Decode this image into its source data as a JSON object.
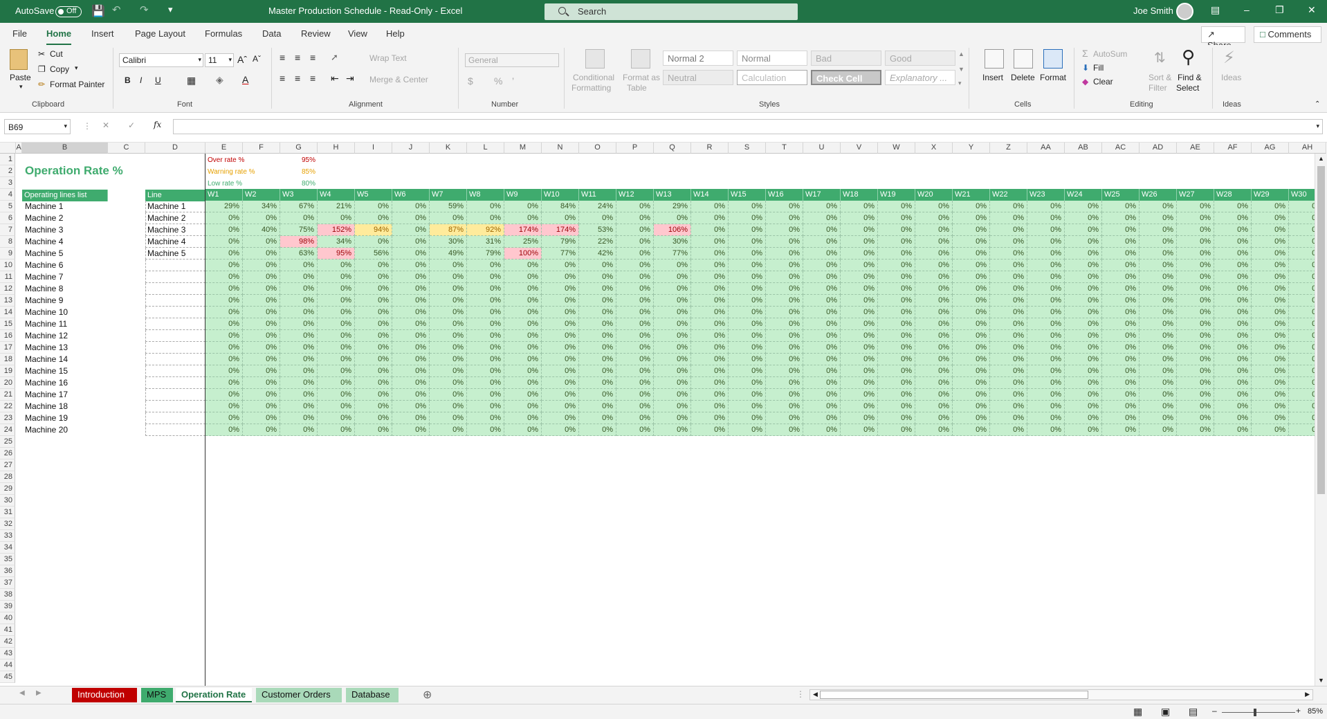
{
  "window": {
    "autosave": "AutoSave",
    "autosave_state": "Off",
    "title": "Master Production Schedule  -  Read-Only  -  Excel",
    "search": "Search",
    "user": "Joe Smith"
  },
  "menu": [
    "File",
    "Home",
    "Insert",
    "Page Layout",
    "Formulas",
    "Data",
    "Review",
    "View",
    "Help"
  ],
  "share": "Share",
  "comments": "Comments",
  "ribbon": {
    "clipboard": {
      "paste": "Paste",
      "cut": "Cut",
      "copy": "Copy",
      "format_painter": "Format Painter",
      "label": "Clipboard"
    },
    "font": {
      "name": "Calibri",
      "size": "11",
      "label": "Font"
    },
    "alignment": {
      "wrap": "Wrap Text",
      "merge": "Merge & Center",
      "label": "Alignment"
    },
    "number": {
      "format": "General",
      "label": "Number"
    },
    "styles": {
      "cond1": "Conditional",
      "cond2": "Formatting",
      "fmt1": "Format as",
      "fmt2": "Table",
      "normal2": "Normal 2",
      "normal": "Normal",
      "bad": "Bad",
      "good": "Good",
      "neutral": "Neutral",
      "calculation": "Calculation",
      "check": "Check Cell",
      "explanatory": "Explanatory ...",
      "label": "Styles"
    },
    "cells": {
      "insert": "Insert",
      "delete": "Delete",
      "format": "Format",
      "label": "Cells"
    },
    "editing": {
      "autosum": "AutoSum",
      "fill": "Fill",
      "clear": "Clear",
      "sort1": "Sort &",
      "sort2": "Filter",
      "find1": "Find &",
      "find2": "Select",
      "label": "Editing"
    },
    "ideas": {
      "btn": "Ideas",
      "label": "Ideas"
    }
  },
  "formula_bar": {
    "name_box": "B69",
    "value": ""
  },
  "sheet": {
    "title": "Operation Rate %",
    "thresholds": [
      {
        "label": "Over rate %",
        "value": "95%",
        "color": "#c00000"
      },
      {
        "label": "Warning rate %",
        "value": "85%",
        "color": "#e6a000"
      },
      {
        "label": "Low rate %",
        "value": "80%",
        "color": "#3fab6e"
      }
    ],
    "list_header": "Operating lines list",
    "line_header": "Line",
    "columns": [
      "A",
      "B",
      "C",
      "D",
      "E",
      "F",
      "G",
      "H",
      "I",
      "J",
      "K",
      "L",
      "M",
      "N",
      "O",
      "P",
      "Q",
      "R",
      "S",
      "T",
      "U",
      "V",
      "W",
      "X",
      "Y",
      "Z",
      "AA",
      "AB",
      "AC",
      "AD",
      "AE",
      "AF",
      "AG",
      "AH"
    ],
    "machines": [
      "Machine 1",
      "Machine 2",
      "Machine 3",
      "Machine 4",
      "Machine 5",
      "Machine 6",
      "Machine 7",
      "Machine 8",
      "Machine 9",
      "Machine 10",
      "Machine 11",
      "Machine 12",
      "Machine 13",
      "Machine 14",
      "Machine 15",
      "Machine 16",
      "Machine 17",
      "Machine 18",
      "Machine 19",
      "Machine 20"
    ],
    "lines": [
      "Machine 1",
      "Machine 2",
      "Machine 3",
      "Machine 4",
      "Machine 5",
      "",
      "",
      "",
      "",
      "",
      "",
      "",
      "",
      "",
      "",
      "",
      "",
      "",
      "",
      ""
    ],
    "weeks": [
      "W1",
      "W2",
      "W3",
      "W4",
      "W5",
      "W6",
      "W7",
      "W8",
      "W9",
      "W10",
      "W11",
      "W12",
      "W13",
      "W14",
      "W15",
      "W16",
      "W17",
      "W18",
      "W19",
      "W20",
      "W21",
      "W22",
      "W23",
      "W24",
      "W25",
      "W26",
      "W27",
      "W28",
      "W29",
      "W30"
    ],
    "rates": [
      [
        "29%",
        "34%",
        "67%",
        "21%",
        "0%",
        "0%",
        "59%",
        "0%",
        "0%",
        "84%",
        "24%",
        "0%",
        "29%"
      ],
      [
        "0%",
        "0%",
        "0%",
        "0%",
        "0%",
        "0%",
        "0%",
        "0%",
        "0%",
        "0%",
        "0%",
        "0%",
        "0%"
      ],
      [
        "0%",
        "40%",
        "75%",
        "152%",
        "94%",
        "0%",
        "87%",
        "92%",
        "174%",
        "174%",
        "53%",
        "0%",
        "106%"
      ],
      [
        "0%",
        "0%",
        "98%",
        "34%",
        "0%",
        "0%",
        "30%",
        "31%",
        "25%",
        "79%",
        "22%",
        "0%",
        "30%"
      ],
      [
        "0%",
        "0%",
        "63%",
        "95%",
        "56%",
        "0%",
        "49%",
        "79%",
        "100%",
        "77%",
        "42%",
        "0%",
        "77%"
      ]
    ],
    "default_rate": "0%"
  },
  "tabs": [
    "Introduction",
    "MPS",
    "Operation Rate",
    "Customer Orders",
    "Database"
  ],
  "status": {
    "zoom": "85%"
  }
}
